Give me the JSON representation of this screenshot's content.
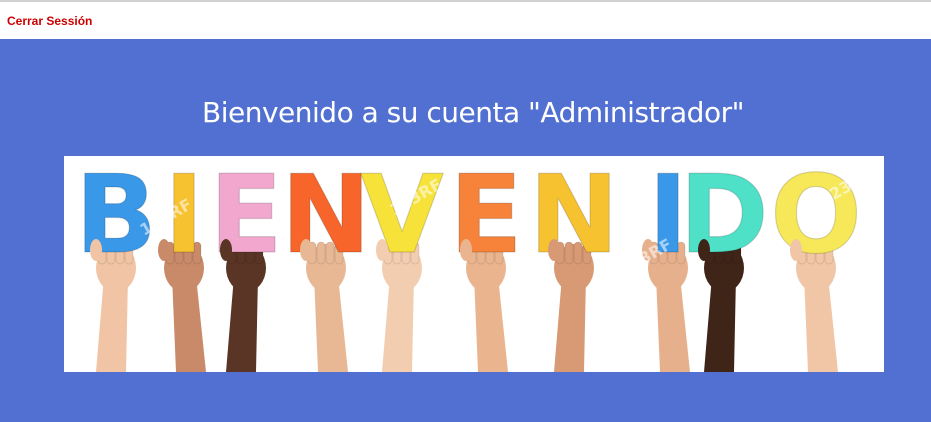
{
  "header": {
    "logout_label": "Cerrar Sessión"
  },
  "main": {
    "welcome_text": "Bienvenido a su cuenta \"Administrador\"",
    "banner": {
      "letters": [
        "B",
        "I",
        "E",
        "N",
        "V",
        "E",
        "N",
        "I",
        "D",
        "O"
      ],
      "letter_colors": [
        "#3a98e8",
        "#f6c230",
        "#f2a7cf",
        "#f7652a",
        "#f7e23a",
        "#f7823a",
        "#f6c230",
        "#3a98e8",
        "#4fe0c8",
        "#f7e85a"
      ],
      "skin_tones": [
        "#f0c4a4",
        "#c88a68",
        "#5a3424",
        "#e8b894",
        "#f3cdb0",
        "#e9b48e",
        "#d89a74",
        "#e7b08c",
        "#3f2518",
        "#f0c6a6"
      ],
      "watermark": "123RF"
    },
    "colors": {
      "hero_bg": "#5170d1",
      "logout": "#cc0000"
    }
  }
}
